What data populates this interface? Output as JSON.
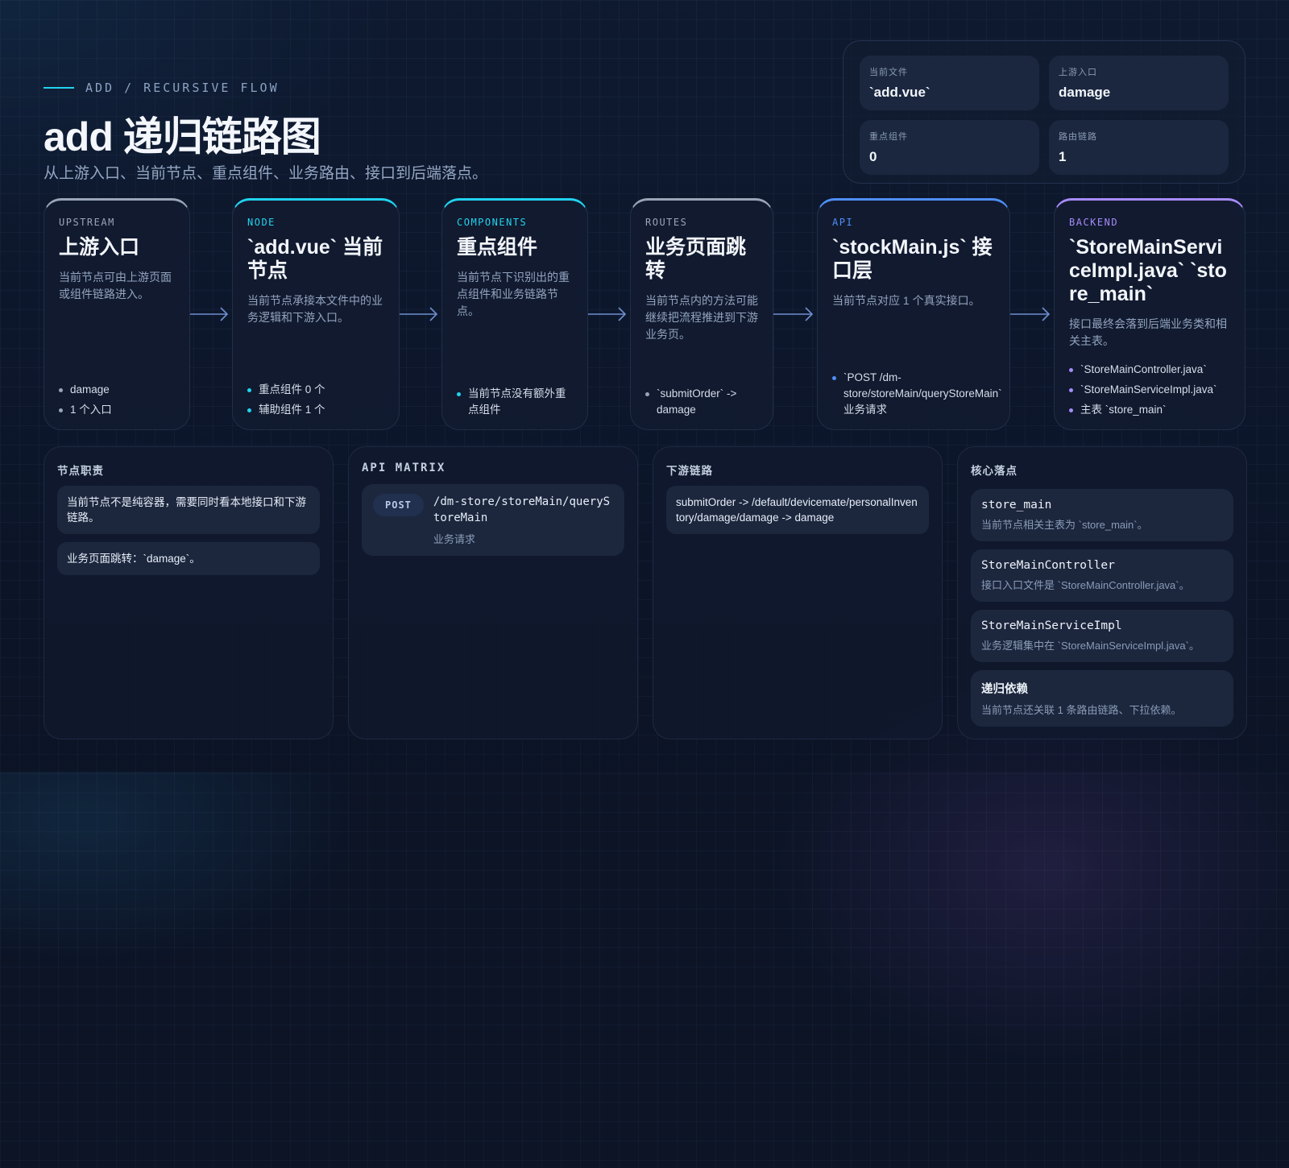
{
  "header": {
    "eyebrow": "ADD / RECURSIVE FLOW",
    "title": "add 递归链路图",
    "subtitle": "从上游入口、当前节点、重点组件、业务路由、接口到后端落点。"
  },
  "stats": [
    {
      "label": "当前文件",
      "value": "`add.vue`"
    },
    {
      "label": "上游入口",
      "value": "damage"
    },
    {
      "label": "重点组件",
      "value": "0"
    },
    {
      "label": "路由链路",
      "value": "1"
    }
  ],
  "flow": [
    {
      "tag": "UPSTREAM",
      "title": "上游入口",
      "desc": "当前节点可由上游页面或组件链路进入。",
      "items": [
        "damage",
        "1 个入口"
      ]
    },
    {
      "tag": "NODE",
      "title": "`add.vue` 当前节点",
      "desc": "当前节点承接本文件中的业务逻辑和下游入口。",
      "items": [
        "重点组件 0 个",
        "辅助组件 1 个"
      ]
    },
    {
      "tag": "COMPONENTS",
      "title": "重点组件",
      "desc": "当前节点下识别出的重点组件和业务链路节点。",
      "items": [
        "当前节点没有额外重点组件"
      ]
    },
    {
      "tag": "ROUTES",
      "title": "业务页面跳转",
      "desc": "当前节点内的方法可能继续把流程推进到下游业务页。",
      "items": [
        "`submitOrder` -> damage"
      ]
    },
    {
      "tag": "API",
      "title": "`stockMain.js` 接口层",
      "desc": "当前节点对应 1 个真实接口。",
      "items": [
        "`POST /dm-store/storeMain/queryStoreMain` 业务请求"
      ]
    },
    {
      "tag": "BACKEND",
      "title": "`StoreMainServiceImpl.java` `store_main`",
      "desc": "接口最终会落到后端业务类和相关主表。",
      "items": [
        "`StoreMainController.java`",
        "`StoreMainServiceImpl.java`",
        "主表 `store_main`"
      ]
    }
  ],
  "panels": {
    "duty": {
      "title": "节点职责",
      "notes": [
        "当前节点不是纯容器，需要同时看本地接口和下游链路。",
        "业务页面跳转：`damage`。"
      ]
    },
    "api": {
      "title": "API MATRIX",
      "method": "POST",
      "path": "/dm-store/storeMain/queryStoreMain",
      "note": "业务请求"
    },
    "downstream": {
      "title": "下游链路",
      "notes": [
        "submitOrder -> /default/devicemate/personalInventory/damage/damage -> damage"
      ]
    },
    "core": {
      "title": "核心落点",
      "items": [
        {
          "title": "store_main",
          "desc": "当前节点相关主表为 `store_main`。"
        },
        {
          "title": "StoreMainController",
          "desc": "接口入口文件是 `StoreMainController.java`。"
        },
        {
          "title": "StoreMainServiceImpl",
          "desc": "业务逻辑集中在 `StoreMainServiceImpl.java`。"
        },
        {
          "title": "递归依赖",
          "desc": "当前节点还关联 1 条路由链路、下拉依赖。"
        }
      ]
    }
  },
  "colors": {
    "cyan": "#22d3ee",
    "gray": "#9aa5b8",
    "blue": "#4f8ff7",
    "purple": "#a78bfa"
  }
}
